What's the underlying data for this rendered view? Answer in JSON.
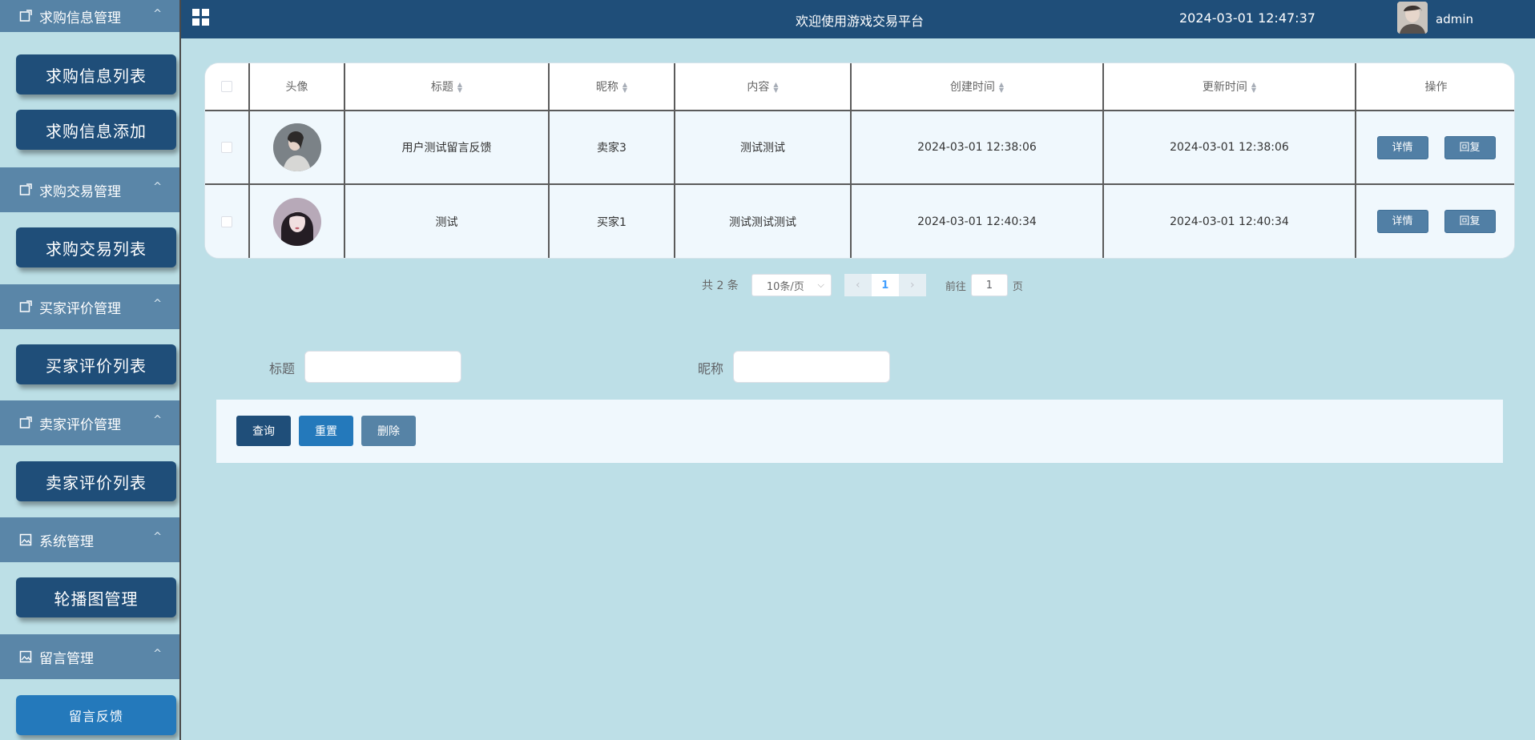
{
  "sidebar": {
    "groups": [
      {
        "label": "求购信息管理",
        "icon": "edit-icon",
        "items": [
          "求购信息列表",
          "求购信息添加"
        ]
      },
      {
        "label": "求购交易管理",
        "icon": "edit-icon",
        "items": [
          "求购交易列表"
        ]
      },
      {
        "label": "买家评价管理",
        "icon": "edit-icon",
        "items": [
          "买家评价列表"
        ]
      },
      {
        "label": "卖家评价管理",
        "icon": "edit-icon",
        "items": [
          "卖家评价列表"
        ]
      },
      {
        "label": "系统管理",
        "icon": "image-icon",
        "items": [
          "轮播图管理"
        ]
      },
      {
        "label": "留言管理",
        "icon": "image-icon",
        "items": [
          "留言反馈"
        ]
      }
    ],
    "chevron": "^"
  },
  "topbar": {
    "title": "欢迎使用游戏交易平台",
    "datetime": "2024-03-01 12:47:37",
    "username": "admin"
  },
  "table": {
    "columns": [
      "头像",
      "标题",
      "昵称",
      "内容",
      "创建时间",
      "更新时间",
      "操作"
    ],
    "rows": [
      {
        "title": "用户测试留言反馈",
        "nickname": "卖家3",
        "content": "测试测试",
        "created": "2024-03-01 12:38:06",
        "updated": "2024-03-01 12:38:06"
      },
      {
        "title": "测试",
        "nickname": "买家1",
        "content": "测试测试测试",
        "created": "2024-03-01 12:40:34",
        "updated": "2024-03-01 12:40:34"
      }
    ],
    "detail_label": "详情",
    "reply_label": "回复"
  },
  "pagination": {
    "total": "共 2 条",
    "page_size": "10条/页",
    "current_page": "1",
    "goto_label": "前往",
    "goto_value": "1",
    "page_word": "页"
  },
  "search": {
    "title_label": "标题",
    "nickname_label": "昵称",
    "query_label": "查询",
    "reset_label": "重置",
    "delete_label": "删除"
  },
  "colors": {
    "nav_dark": "#1f4e79",
    "menu_header": "#5a86a8",
    "background": "#bddfe7",
    "active_item": "#2479bb"
  }
}
